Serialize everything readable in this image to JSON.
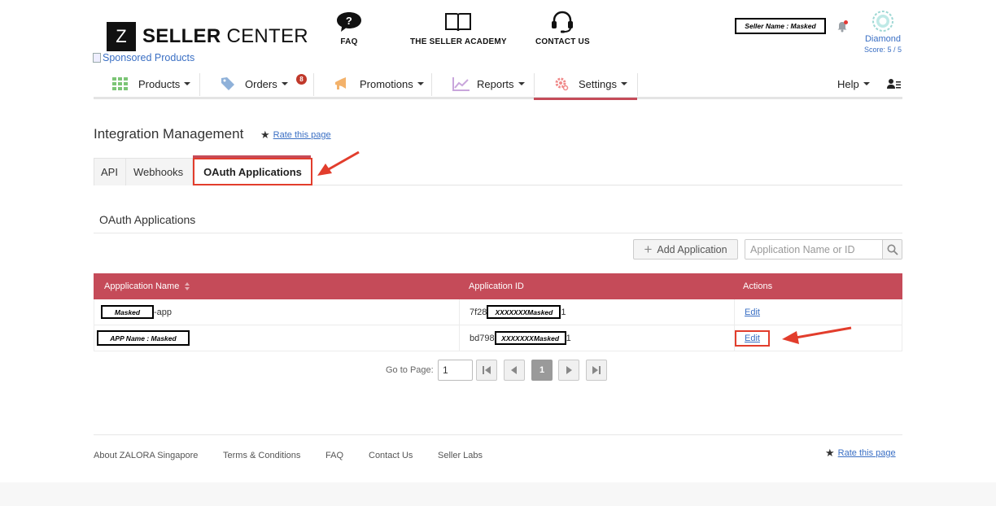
{
  "header": {
    "logo_letter": "Z",
    "logo_bold": "SELLER",
    "logo_light": "CENTER",
    "sponsored": "Sponsored Products",
    "links": [
      {
        "label": "FAQ",
        "icon": "question-bubble-icon"
      },
      {
        "label": "THE SELLER ACADEMY",
        "icon": "book-icon"
      },
      {
        "label": "CONTACT US",
        "icon": "headset-icon"
      }
    ],
    "seller_name": "Seller Name : Masked",
    "tier": "Diamond",
    "score": "Score: 5 / 5"
  },
  "nav": {
    "items": [
      {
        "label": "Products",
        "icon": "grid-icon"
      },
      {
        "label": "Orders",
        "icon": "tag-icon",
        "badge": "8"
      },
      {
        "label": "Promotions",
        "icon": "megaphone-icon"
      },
      {
        "label": "Reports",
        "icon": "chart-icon"
      },
      {
        "label": "Settings",
        "icon": "gear-icon"
      }
    ],
    "help": "Help"
  },
  "page": {
    "title": "Integration Management",
    "rate": "Rate this page"
  },
  "tabs": [
    "API",
    "Webhooks",
    "OAuth Applications"
  ],
  "section_title": "OAuth Applications",
  "controls": {
    "add_label": "Add Application",
    "search_placeholder": "Application Name or ID"
  },
  "table": {
    "columns": [
      "Appplication Name",
      "Application ID",
      "Actions"
    ],
    "rows": [
      {
        "name_mask": "Masked",
        "name_suffix": "-app",
        "id_prefix": "7f28",
        "id_mask": "XXXXXXXMasked",
        "id_suffix": "1",
        "action": "Edit"
      },
      {
        "name_mask": "APP Name : Masked",
        "name_suffix": "",
        "id_prefix": "bd798",
        "id_mask": "XXXXXXXMasked",
        "id_suffix": "1",
        "action": "Edit"
      }
    ]
  },
  "pagination": {
    "goto_label": "Go to Page:",
    "page_value": "1",
    "current": "1"
  },
  "footer": {
    "links": [
      "About ZALORA Singapore",
      "Terms & Conditions",
      "FAQ",
      "Contact Us",
      "Seller Labs"
    ],
    "rate": "Rate this page"
  },
  "colors": {
    "accent": "#c54b59",
    "link": "#3a6fc4",
    "annotation": "#e23d2c"
  }
}
